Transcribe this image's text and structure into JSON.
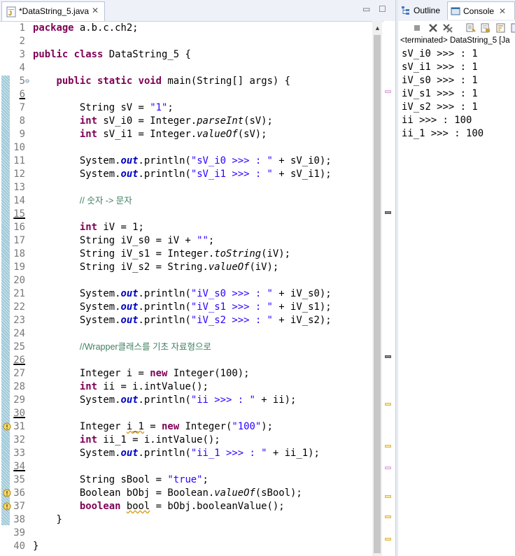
{
  "editor": {
    "tab_title": "*DataString_5.java",
    "lines": [
      {
        "n": "1",
        "h": "<span class='k'>package</span> a.b.c.ch2;"
      },
      {
        "n": "2",
        "h": ""
      },
      {
        "n": "3",
        "h": "<span class='k'>public</span> <span class='k'>class</span> DataString_5 {"
      },
      {
        "n": "4",
        "h": ""
      },
      {
        "n": "5",
        "h": "    <span class='k'>public</span> <span class='k'>static</span> <span class='k'>void</span> main(String[] args) {",
        "fold": true
      },
      {
        "n": "6",
        "h": "",
        "cur": true
      },
      {
        "n": "7",
        "h": "        String sV = <span class='s'>\"1\"</span>;"
      },
      {
        "n": "8",
        "h": "        <span class='k'>int</span> sV_i0 = Integer.<span class='i'>parseInt</span>(sV);"
      },
      {
        "n": "9",
        "h": "        <span class='k'>int</span> sV_i1 = Integer.<span class='i'>valueOf</span>(sV);"
      },
      {
        "n": "10",
        "h": ""
      },
      {
        "n": "11",
        "h": "        System.<span class='f'>out</span>.println(<span class='s'>\"sV_i0 &gt;&gt;&gt; : \"</span> + sV_i0);"
      },
      {
        "n": "12",
        "h": "        System.<span class='f'>out</span>.println(<span class='s'>\"sV_i1 &gt;&gt;&gt; : \"</span> + sV_i1);"
      },
      {
        "n": "13",
        "h": ""
      },
      {
        "n": "14",
        "h": "        <span class='c'>// 숫자 -&gt; 문자</span>"
      },
      {
        "n": "15",
        "h": "",
        "cur": true
      },
      {
        "n": "16",
        "h": "        <span class='k'>int</span> iV = 1;"
      },
      {
        "n": "17",
        "h": "        String iV_s0 = iV + <span class='s'>\"\"</span>;"
      },
      {
        "n": "18",
        "h": "        String iV_s1 = Integer.<span class='i'>toString</span>(iV);"
      },
      {
        "n": "19",
        "h": "        String iV_s2 = String.<span class='i'>valueOf</span>(iV);"
      },
      {
        "n": "20",
        "h": ""
      },
      {
        "n": "21",
        "h": "        System.<span class='f'>out</span>.println(<span class='s'>\"iV_s0 &gt;&gt;&gt; : \"</span> + iV_s0);"
      },
      {
        "n": "22",
        "h": "        System.<span class='f'>out</span>.println(<span class='s'>\"iV_s1 &gt;&gt;&gt; : \"</span> + iV_s1);"
      },
      {
        "n": "23",
        "h": "        System.<span class='f'>out</span>.println(<span class='s'>\"iV_s2 &gt;&gt;&gt; : \"</span> + iV_s2);"
      },
      {
        "n": "24",
        "h": ""
      },
      {
        "n": "25",
        "h": "        <span class='c'>//Wrapper클래스를 기초 자료형으로</span>"
      },
      {
        "n": "26",
        "h": "",
        "cur": true
      },
      {
        "n": "27",
        "h": "        Integer i = <span class='k'>new</span> Integer(100);"
      },
      {
        "n": "28",
        "h": "        <span class='k'>int</span> ii = i.intValue();"
      },
      {
        "n": "29",
        "h": "        System.<span class='f'>out</span>.println(<span class='s'>\"ii &gt;&gt;&gt; : \"</span> + ii);"
      },
      {
        "n": "30",
        "h": "",
        "cur": true
      },
      {
        "n": "31",
        "h": "        Integer <span class='w'>i_1</span> = <span class='k'>new</span> Integer(<span class='s'>\"100\"</span>);",
        "warn": true
      },
      {
        "n": "32",
        "h": "        <span class='k'>int</span> ii_1 = i.intValue();"
      },
      {
        "n": "33",
        "h": "        System.<span class='f'>out</span>.println(<span class='s'>\"ii_1 &gt;&gt;&gt; : \"</span> + ii_1);"
      },
      {
        "n": "34",
        "h": "",
        "cur": true
      },
      {
        "n": "35",
        "h": "        String sBool = <span class='s'>\"true\"</span>;"
      },
      {
        "n": "36",
        "h": "        Boolean bObj = Boolean.<span class='i'>valueOf</span>(sBool);",
        "warn": true
      },
      {
        "n": "37",
        "h": "        <span class='k'>boolean</span> <span class='w'>bool</span> = bObj.booleanValue();",
        "warn": true
      },
      {
        "n": "38",
        "h": "    }"
      },
      {
        "n": "39",
        "h": ""
      },
      {
        "n": "40",
        "h": "}"
      }
    ]
  },
  "right_pane": {
    "outline_tab": "Outline",
    "console_tab": "Console",
    "status": "<terminated> DataString_5 [Ja",
    "output": [
      "sV_i0 >>> : 1",
      "sV_i1 >>> : 1",
      "iV_s0 >>> : 1",
      "iV_s1 >>> : 1",
      "iV_s2 >>> : 1",
      "ii >>> : 100",
      "ii_1 >>> : 100"
    ]
  }
}
